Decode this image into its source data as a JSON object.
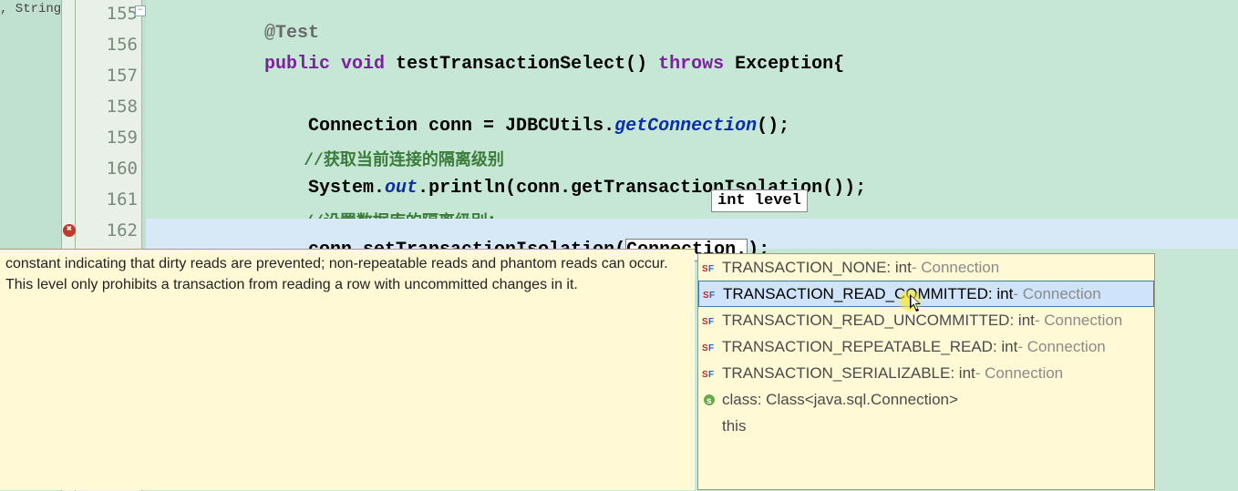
{
  "outline_fragment": ", String",
  "lines": {
    "155": {
      "no": "155"
    },
    "156": {
      "no": "156"
    },
    "157": {
      "no": "157"
    },
    "158": {
      "no": "158"
    },
    "159": {
      "no": "159"
    },
    "160": {
      "no": "160"
    },
    "161": {
      "no": "161"
    },
    "162": {
      "no": "162"
    }
  },
  "code": {
    "l155_ann": "@Test",
    "l156_kw1": "public",
    "l156_kw2": "void",
    "l156_id": " testTransactionSelect() ",
    "l156_kw3": "throws",
    "l156_tail": " Exception{",
    "l158_a": "    Connection conn = JDBCUtils.",
    "l158_b": "getConnection",
    "l158_c": "();",
    "l159_cmt": "    //获取当前连接的隔离级别",
    "l160_a": "    System.",
    "l160_b": "out",
    "l160_c": ".println(conn.getTransactionIsolation());",
    "l161_cmt": "    //设置数据库的隔离级别：",
    "l162_a": "    conn.setTransactionIsolation(",
    "l162_b": "Connection.",
    "l162_c": ");"
  },
  "param_hint": "int level",
  "doc_text": "constant indicating that dirty reads are prevented; non-repeatable reads and phantom reads can occur. This level only prohibits a transaction from reading a row with uncommitted changes in it.",
  "autocomplete": {
    "items": [
      {
        "name": "TRANSACTION_NONE",
        "t": " : int",
        "from": " - Connection",
        "k": "sf"
      },
      {
        "name": "TRANSACTION_READ_COMMITTED",
        "t": " : int",
        "from": " - Connection",
        "k": "sf"
      },
      {
        "name": "TRANSACTION_READ_UNCOMMITTED",
        "t": " : int",
        "from": " - Connection",
        "k": "sf"
      },
      {
        "name": "TRANSACTION_REPEATABLE_READ",
        "t": " : int",
        "from": " - Connection",
        "k": "sf"
      },
      {
        "name": "TRANSACTION_SERIALIZABLE",
        "t": " : int",
        "from": " - Connection",
        "k": "sf"
      },
      {
        "name": "class",
        "t": " : Class<java.sql.Connection>",
        "from": "",
        "k": "cls"
      },
      {
        "name": "this",
        "t": "",
        "from": "",
        "k": "none"
      }
    ],
    "selected_index": 1
  }
}
